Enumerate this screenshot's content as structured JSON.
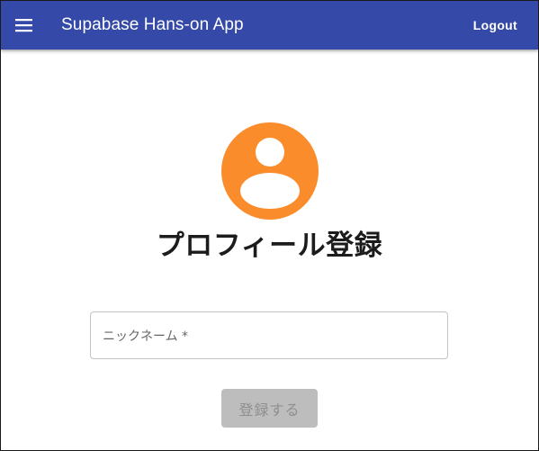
{
  "app_bar": {
    "menu_icon": "menu-icon",
    "title": "Supabase Hans-on App",
    "logout_label": "Logout",
    "background_color": "#3449a8"
  },
  "main": {
    "avatar_icon": "account-circle-icon",
    "avatar_color": "#fb8c2c",
    "heading": "プロフィール登録",
    "nickname": {
      "label": "ニックネーム *",
      "value": ""
    },
    "submit_label": "登録する",
    "submit_disabled": true
  }
}
